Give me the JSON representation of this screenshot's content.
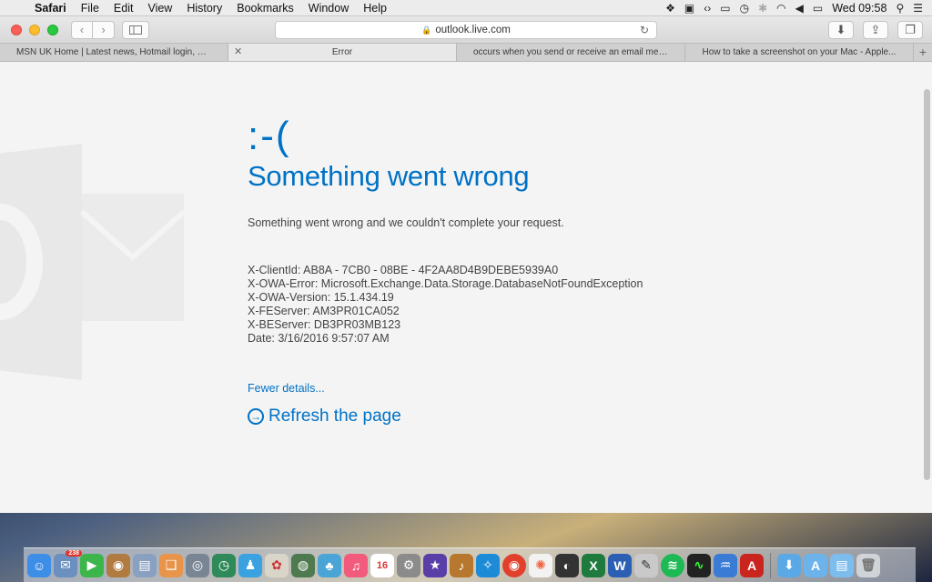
{
  "menubar": {
    "app_name": "Safari",
    "items": [
      "File",
      "Edit",
      "View",
      "History",
      "Bookmarks",
      "Window",
      "Help"
    ],
    "clock": "Wed 09:58"
  },
  "browser": {
    "address": "outlook.live.com",
    "tabs": [
      {
        "label": "MSN UK Home | Latest news, Hotmail login, Outlo...",
        "active": false
      },
      {
        "label": "Error",
        "active": true
      },
      {
        "label": "occurs when you send or receive an email mess...",
        "active": false
      },
      {
        "label": "How to take a screenshot on your Mac - Apple...",
        "active": false
      }
    ]
  },
  "page": {
    "frown": ":-(",
    "headline": "Something went wrong",
    "description": "Something went wrong and we couldn't complete your request.",
    "details": [
      "X-ClientId: AB8A - 7CB0 - 08BE - 4F2AA8D4B9DEBE5939A0",
      "X-OWA-Error: Microsoft.Exchange.Data.Storage.DatabaseNotFoundException",
      "X-OWA-Version: 15.1.434.19",
      "X-FEServer: AM3PR01CA052",
      "X-BEServer: DB3PR03MB123",
      "Date: 3/16/2016 9:57:07 AM"
    ],
    "fewer_details": "Fewer details...",
    "refresh": "Refresh the page",
    "accent_color": "#0072c6"
  },
  "dock": {
    "mail_badge": "238",
    "calendar_day": "16"
  }
}
